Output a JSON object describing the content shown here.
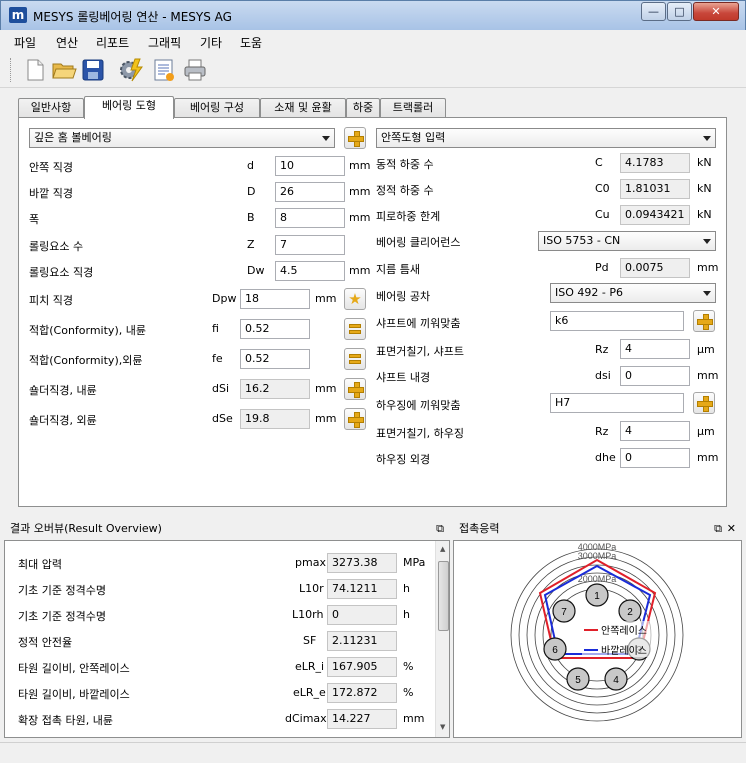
{
  "window": {
    "title": "MESYS 롤링베어링 연산 - MESYS AG",
    "icon_letter": "m",
    "min_glyph": "—",
    "max_glyph": "□",
    "close_glyph": "✕"
  },
  "menu": [
    "파일",
    "연산",
    "리포트",
    "그래픽",
    "기타",
    "도움"
  ],
  "toolbar": [
    "new-document-icon",
    "open-folder-icon",
    "save-disk-icon",
    "calculate-gear-icon",
    "report-icon",
    "print-icon"
  ],
  "tabs": [
    "일반사항",
    "베어링 도형",
    "베어링 구성",
    "소재 및 윤활",
    "하중",
    "트랙롤러"
  ],
  "left": {
    "bearing_type": "깊은 홈 볼베어링",
    "rows": [
      {
        "label": "안쪽 직경",
        "sym": "d",
        "value": "10",
        "unit": "mm"
      },
      {
        "label": "바깥 직경",
        "sym": "D",
        "value": "26",
        "unit": "mm"
      },
      {
        "label": "폭",
        "sym": "B",
        "value": "8",
        "unit": "mm"
      },
      {
        "label": "롤링요소 수",
        "sym": "Z",
        "value": "7",
        "unit": ""
      },
      {
        "label": "롤링요소 직경",
        "sym": "Dw",
        "value": "4.5",
        "unit": "mm"
      },
      {
        "label": "피치 직경",
        "sym": "Dpw",
        "value": "18",
        "unit": "mm"
      },
      {
        "label": "적합(Conformity), 내륜",
        "sym": "fi",
        "value": "0.52",
        "unit": ""
      },
      {
        "label": "적합(Conformity),외륜",
        "sym": "fe",
        "value": "0.52",
        "unit": ""
      },
      {
        "label": "숄더직경, 내륜",
        "sym": "dSi",
        "value": "16.2",
        "unit": "mm"
      },
      {
        "label": "숄더직경, 외륜",
        "sym": "dSe",
        "value": "19.8",
        "unit": "mm"
      }
    ]
  },
  "right": {
    "geometry_input": "안쪽도형 입력",
    "c": {
      "label": "동적 하중 수",
      "sym": "C",
      "value": "4.1783",
      "unit": "kN"
    },
    "c0": {
      "label": "정적 하중 수",
      "sym": "C0",
      "value": "1.81031",
      "unit": "kN"
    },
    "cu": {
      "label": "피로하중 한계",
      "sym": "Cu",
      "value": "0.0943421",
      "unit": "kN"
    },
    "clearance": {
      "label": "베어링 클리어런스",
      "value": "ISO 5753 - CN"
    },
    "pd": {
      "label": "지름 틈새",
      "sym": "Pd",
      "value": "0.0075",
      "unit": "mm"
    },
    "tolerance": {
      "label": "베어링 공차",
      "value": "ISO 492 - P6"
    },
    "shaft_fit": {
      "label": "샤프트에 끼워맞춤",
      "value": "k6"
    },
    "rz_shaft": {
      "label": "표면거칠기, 샤프트",
      "sym": "Rz",
      "value": "4",
      "unit": "µm"
    },
    "dsi": {
      "label": "샤프트 내경",
      "sym": "dsi",
      "value": "0",
      "unit": "mm"
    },
    "housing_fit": {
      "label": "하우징에 끼워맞춤",
      "value": "H7"
    },
    "rz_housing": {
      "label": "표면거칠기, 하우징",
      "sym": "Rz",
      "value": "4",
      "unit": "µm"
    },
    "dhe": {
      "label": "하우징 외경",
      "sym": "dhe",
      "value": "0",
      "unit": "mm"
    }
  },
  "results": {
    "title": "결과 오버뷰(Result Overview)",
    "rows": [
      {
        "label": "최대 압력",
        "sym": "pmax",
        "value": "3273.38",
        "unit": "MPa"
      },
      {
        "label": "기초 기준 정격수명",
        "sym": "L10r",
        "value": "74.1211",
        "unit": "h"
      },
      {
        "label": "기초 기준 정격수명",
        "sym": "L10rh",
        "value": "0",
        "unit": "h"
      },
      {
        "label": "정적 안전율",
        "sym": "SF",
        "value": "2.11231",
        "unit": ""
      },
      {
        "label": "타원 길이비, 안쪽레이스",
        "sym": "eLR_i",
        "value": "167.905",
        "unit": "%"
      },
      {
        "label": "타원 길이비, 바깥레이스",
        "sym": "eLR_e",
        "value": "172.872",
        "unit": "%"
      },
      {
        "label": "확장 접촉 타원, 내륜",
        "sym": "dCimax",
        "value": "14.227",
        "unit": "mm"
      }
    ]
  },
  "contact": {
    "title": "접촉응력",
    "ring_labels": [
      "4000MPa",
      "3000MPa",
      "2000MPa"
    ],
    "legend": [
      {
        "name": "안쪽레이스",
        "color": "#e0202a"
      },
      {
        "name": "바깥레이스",
        "color": "#1a2cd8"
      }
    ],
    "balls": [
      "1",
      "2",
      "3",
      "4",
      "5",
      "6",
      "7"
    ]
  }
}
